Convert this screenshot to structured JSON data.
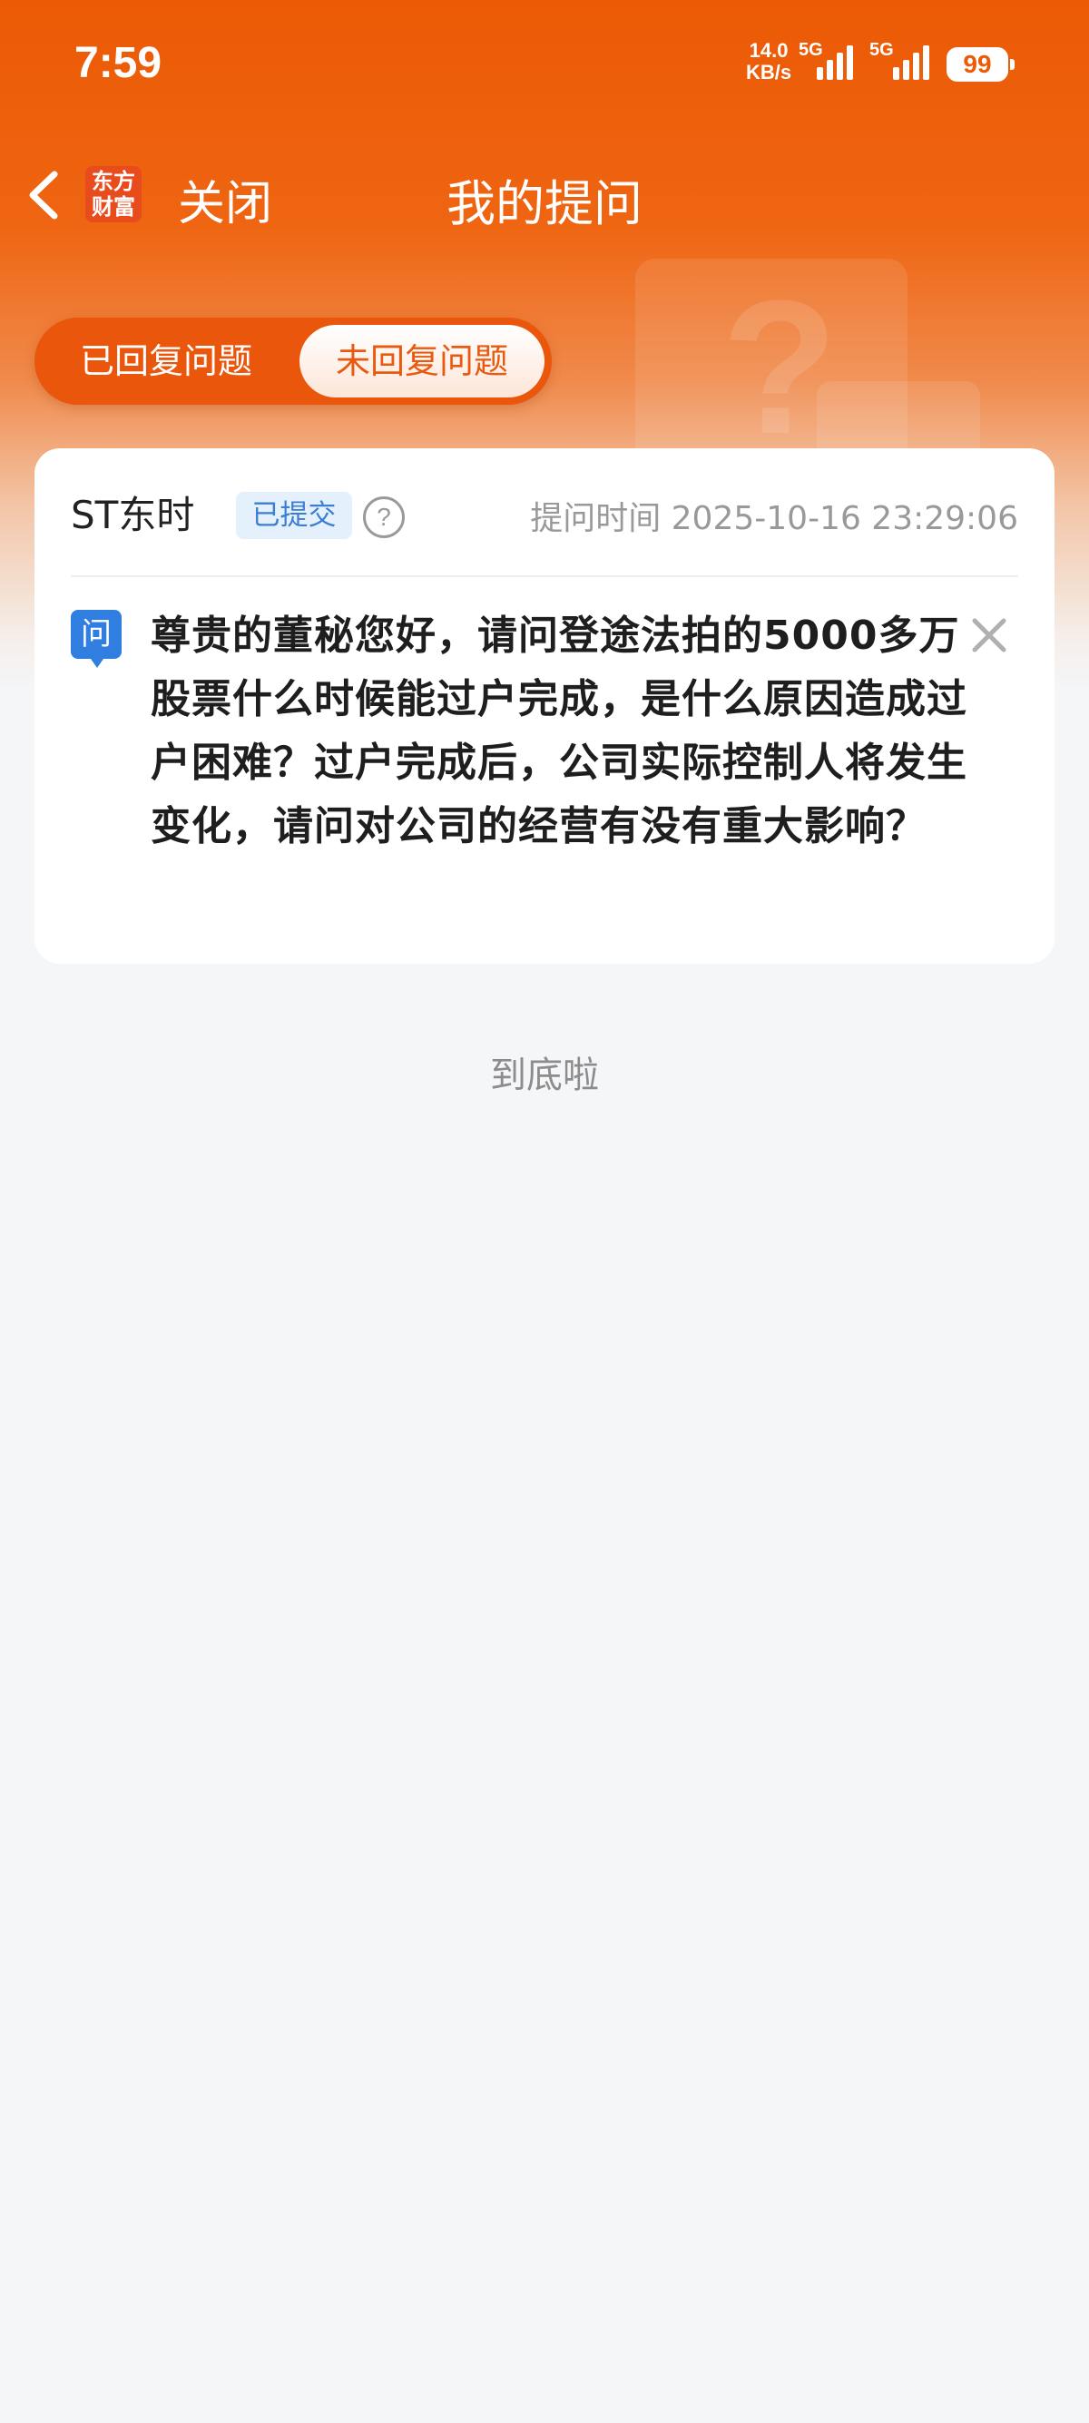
{
  "status_bar": {
    "time": "7:59",
    "network_speed_value": "14.0",
    "network_speed_unit": "KB/s",
    "sim1_label": "5G",
    "sim2_label": "5G",
    "battery": "99"
  },
  "nav": {
    "logo_line1": "东方",
    "logo_line2": "财富",
    "close_label": "关闭",
    "title": "我的提问"
  },
  "tabs": [
    {
      "label": "已回复问题",
      "active": false
    },
    {
      "label": "未回复问题",
      "active": true
    }
  ],
  "card": {
    "company": "ST东时",
    "status_badge": "已提交",
    "ask_time": "提问时间 2025-10-16 23:29:06",
    "question_icon": "问",
    "question": "尊贵的董秘您好，请问登途法拍的5000多万股票什么时候能过户完成，是什么原因造成过户困难？过户完成后，公司实际控制人将发生变化，请问对公司的经营有没有重大影响？"
  },
  "footer": {
    "end_text": "到底啦"
  },
  "colors": {
    "brand_orange": "#ec5a05",
    "badge_blue": "#3c7ed0",
    "question_icon_blue": "#2f7ee0"
  },
  "icons": [
    "back-chevron-icon",
    "help-icon",
    "close-icon",
    "question-icon",
    "signal-icon",
    "battery-icon"
  ]
}
